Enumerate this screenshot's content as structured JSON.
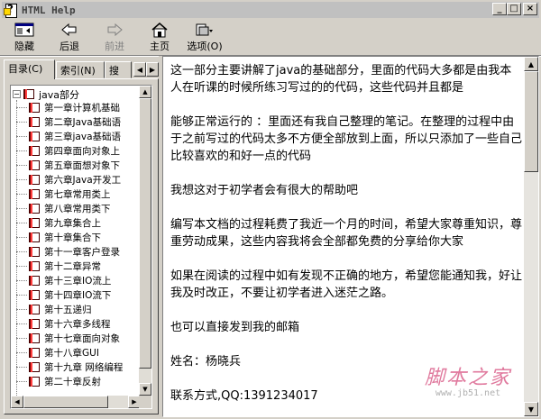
{
  "window": {
    "title": "HTML Help"
  },
  "window_buttons": {
    "minimize": "_",
    "maximize": "□",
    "close": "×"
  },
  "toolbar": {
    "hide": "隐藏",
    "back": "后退",
    "forward": "前进",
    "home": "主页",
    "options": "选项(O)"
  },
  "tabs": {
    "contents": "目录(C)",
    "index": "索引(N)",
    "search": "搜"
  },
  "tree": {
    "root": "java部分",
    "items": [
      "第一章计算机基础",
      "第二章Java基础语",
      "第三章java基础语",
      "第四章面向对象上",
      "第五章面想对象下",
      "第六章Java开发工",
      "第七章常用类上",
      "第八章常用类下",
      "第九章集合上",
      "第十章集合下",
      "第十一章客户登录",
      "第十二章异常",
      "第十三章IO流上",
      "第十四章IO流下",
      "第十五递归",
      "第十六章多线程",
      "第十七章面向对象",
      "第十八章GUI",
      "第十九章 网络编程",
      "第二十章反射"
    ]
  },
  "content": {
    "p1": "这一部分主要讲解了java的基础部分，里面的代码大多都是由我本人在听课的时候所练习写过的的代码，这些代码并且都是",
    "p2": "能够正常运行的 ：里面还有我自己整理的笔记。在整理的过程中由于之前写过的代码太多不方便全部放到上面，所以只添加了一些自己比较喜欢的和好一点的代码",
    "p3": "我想这对于初学者会有很大的帮助吧",
    "p4": "编写本文档的过程耗费了我近一个月的时间，希望大家尊重知识，尊重劳动成果，这些内容我将会全部都免费的分享给你大家",
    "p5": "如果在阅读的过程中如有发现不正确的地方，希望您能通知我，好让我及时改正，不要让初学者进入迷茫之路。",
    "p6": "也可以直接发到我的邮箱",
    "p7": "姓名：杨晓兵",
    "p8": "联系方式,QQ:1391234017"
  },
  "watermark": {
    "text": "脚本之家",
    "url": "www.jb51.net"
  }
}
